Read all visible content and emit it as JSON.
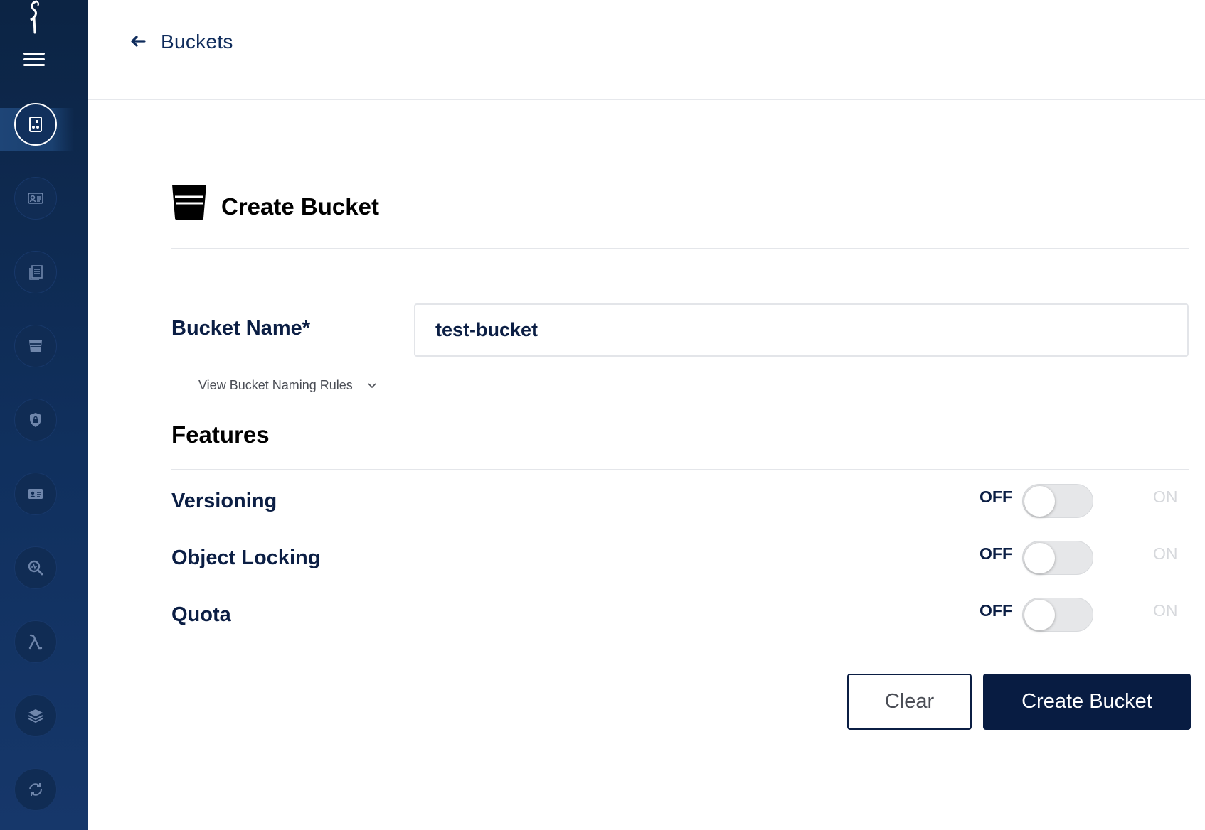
{
  "app": {
    "logo_icon": "minio-flamingo-logo-icon",
    "menu_icon": "hamburger-menu-icon"
  },
  "sidebar": {
    "items": [
      {
        "icon": "buckets-icon",
        "active": true
      },
      {
        "icon": "identity-icon",
        "active": false
      },
      {
        "icon": "logs-icon",
        "active": false
      },
      {
        "icon": "bucket-icon",
        "active": false
      },
      {
        "icon": "security-icon",
        "active": false
      },
      {
        "icon": "license-icon",
        "active": false
      },
      {
        "icon": "monitoring-icon",
        "active": false
      },
      {
        "icon": "lambda-icon",
        "active": false
      },
      {
        "icon": "tiers-icon",
        "active": false
      },
      {
        "icon": "replication-icon",
        "active": false
      }
    ]
  },
  "header": {
    "back_icon": "back-arrow-icon",
    "title": "Buckets"
  },
  "form": {
    "title": "Create Bucket",
    "title_icon": "bucket-icon",
    "bucket_name_label": "Bucket Name*",
    "bucket_name_value": "test-bucket",
    "naming_rules_label": "View Bucket Naming Rules",
    "features_title": "Features",
    "features": [
      {
        "label": "Versioning",
        "off": "OFF",
        "on": "ON",
        "enabled": false
      },
      {
        "label": "Object Locking",
        "off": "OFF",
        "on": "ON",
        "enabled": false
      },
      {
        "label": "Quota",
        "off": "OFF",
        "on": "ON",
        "enabled": false
      }
    ],
    "clear_label": "Clear",
    "create_label": "Create Bucket"
  },
  "colors": {
    "sidebar": "#0c2444",
    "primary": "#081c42",
    "toggle_off": "#e6e7e9",
    "on_label_disabled": "#d6d8dc"
  }
}
